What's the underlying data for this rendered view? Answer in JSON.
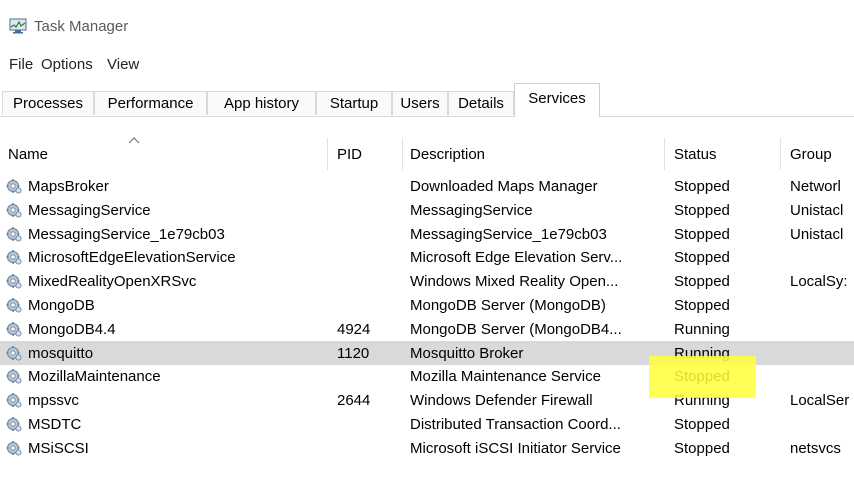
{
  "window": {
    "title": "Task Manager",
    "icon": "task-manager-icon"
  },
  "menu": [
    "File",
    "Options",
    "View"
  ],
  "tabs": [
    "Processes",
    "Performance",
    "App history",
    "Startup",
    "Users",
    "Details",
    "Services"
  ],
  "active_tab": "Services",
  "columns": [
    "Name",
    "PID",
    "Description",
    "Status",
    "Group"
  ],
  "sort_column": "Name",
  "rows": [
    {
      "name": "MapsBroker",
      "pid": "",
      "desc": "Downloaded Maps Manager",
      "status": "Stopped",
      "group": "Networl"
    },
    {
      "name": "MessagingService",
      "pid": "",
      "desc": "MessagingService",
      "status": "Stopped",
      "group": "Unistacl"
    },
    {
      "name": "MessagingService_1e79cb03",
      "pid": "",
      "desc": "MessagingService_1e79cb03",
      "status": "Stopped",
      "group": "Unistacl"
    },
    {
      "name": "MicrosoftEdgeElevationService",
      "pid": "",
      "desc": "Microsoft Edge Elevation Serv...",
      "status": "Stopped",
      "group": ""
    },
    {
      "name": "MixedRealityOpenXRSvc",
      "pid": "",
      "desc": "Windows Mixed Reality Open...",
      "status": "Stopped",
      "group": "LocalSy:"
    },
    {
      "name": "MongoDB",
      "pid": "",
      "desc": "MongoDB Server (MongoDB)",
      "status": "Stopped",
      "group": ""
    },
    {
      "name": "MongoDB4.4",
      "pid": "4924",
      "desc": "MongoDB Server (MongoDB4...",
      "status": "Running",
      "group": ""
    },
    {
      "name": "mosquitto",
      "pid": "1120",
      "desc": "Mosquitto Broker",
      "status": "Running",
      "group": ""
    },
    {
      "name": "MozillaMaintenance",
      "pid": "",
      "desc": "Mozilla Maintenance Service",
      "status": "Stopped",
      "group": ""
    },
    {
      "name": "mpssvc",
      "pid": "2644",
      "desc": "Windows Defender Firewall",
      "status": "Running",
      "group": "LocalSer"
    },
    {
      "name": "MSDTC",
      "pid": "",
      "desc": "Distributed Transaction Coord...",
      "status": "Stopped",
      "group": ""
    },
    {
      "name": "MSiSCSI",
      "pid": "",
      "desc": "Microsoft iSCSI Initiator Service",
      "status": "Stopped",
      "group": "netsvcs"
    }
  ],
  "selected_row": "mosquitto",
  "highlight_color": "#ffff3b",
  "selection_color": "#d9d9d9"
}
